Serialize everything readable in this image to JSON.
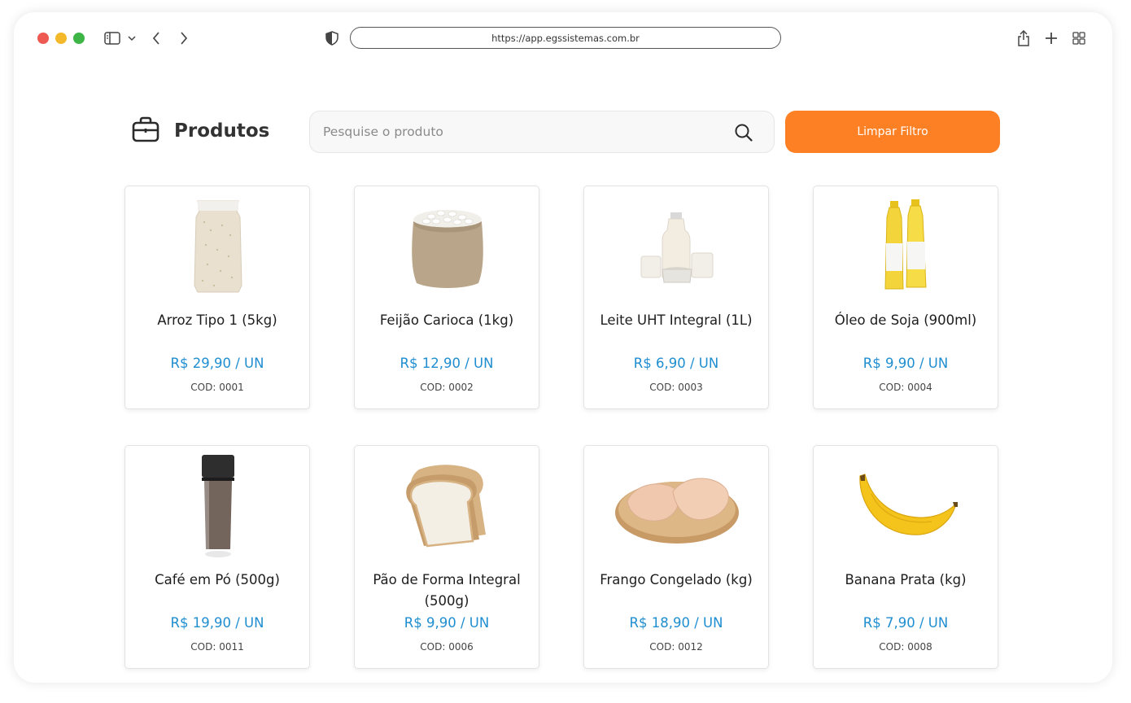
{
  "browser": {
    "url": "https://app.egssistemas.com.br"
  },
  "header": {
    "title": "Produtos",
    "title_icon": "briefcase-icon",
    "search_placeholder": "Pesquise o produto",
    "search_value": "",
    "clear_button": "Limpar Filtro"
  },
  "colors": {
    "accent": "#fd8024",
    "price": "#1f8ed0"
  },
  "products": [
    {
      "name": "Arroz Tipo 1 (5kg)",
      "price": "R$ 29,90 / UN",
      "code": "COD: 0001",
      "image": "rice-bag"
    },
    {
      "name": "Feijão Carioca (1kg)",
      "price": "R$ 12,90 / UN",
      "code": "COD: 0002",
      "image": "bean-sack"
    },
    {
      "name": "Leite UHT Integral (1L)",
      "price": "R$ 6,90 / UN",
      "code": "COD: 0003",
      "image": "milk-bottle"
    },
    {
      "name": "Óleo de Soja (900ml)",
      "price": "R$ 9,90 / UN",
      "code": "COD: 0004",
      "image": "oil-bottles"
    },
    {
      "name": "Café em Pó (500g)",
      "price": "R$ 19,90 / UN",
      "code": "COD: 0011",
      "image": "coffee-jar"
    },
    {
      "name": "Pão de Forma Integral (500g)",
      "price": "R$ 9,90 / UN",
      "code": "COD: 0006",
      "image": "bread-slices"
    },
    {
      "name": "Frango Congelado (kg)",
      "price": "R$ 18,90 / UN",
      "code": "COD: 0012",
      "image": "chicken-board"
    },
    {
      "name": "Banana Prata (kg)",
      "price": "R$ 7,90 / UN",
      "code": "COD: 0008",
      "image": "banana"
    }
  ]
}
